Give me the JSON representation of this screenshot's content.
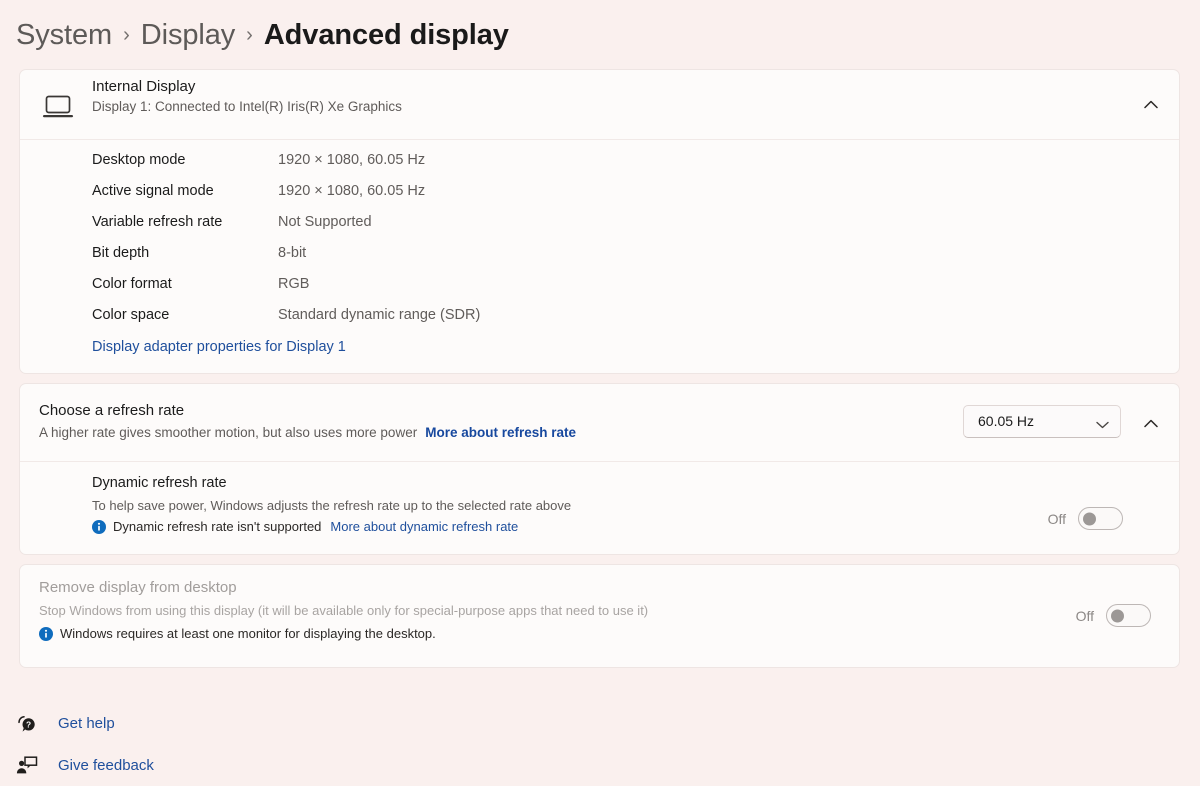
{
  "breadcrumb": {
    "items": [
      {
        "label": "System",
        "current": false
      },
      {
        "label": "Display",
        "current": false
      },
      {
        "label": "Advanced display",
        "current": true
      }
    ],
    "separator": "›"
  },
  "display_card": {
    "title": "Internal Display",
    "subtitle": "Display 1: Connected to Intel(R) Iris(R) Xe Graphics",
    "icon": "laptop-icon",
    "expander_icon": "chevron-up-icon",
    "details": [
      {
        "label": "Desktop mode",
        "value": "1920 × 1080, 60.05 Hz"
      },
      {
        "label": "Active signal mode",
        "value": "1920 × 1080, 60.05 Hz"
      },
      {
        "label": "Variable refresh rate",
        "value": "Not Supported"
      },
      {
        "label": "Bit depth",
        "value": "8-bit"
      },
      {
        "label": "Color format",
        "value": "RGB"
      },
      {
        "label": "Color space",
        "value": "Standard dynamic range (SDR)"
      }
    ],
    "adapter_link": "Display adapter properties for Display 1"
  },
  "refresh_card": {
    "title": "Choose a refresh rate",
    "description": "A higher rate gives smoother motion, but also uses more power",
    "more_link": "More about refresh rate",
    "dropdown_value": "60.05 Hz",
    "dropdown_icon": "chevron-down-icon",
    "expander_icon": "chevron-up-icon",
    "dynamic": {
      "title": "Dynamic refresh rate",
      "description": "To help save power, Windows adjusts the refresh rate up to the selected rate above",
      "info_icon": "info-icon",
      "info_text": "Dynamic refresh rate isn't supported",
      "info_link": "More about dynamic refresh rate",
      "toggle_label": "Off",
      "toggle_state": "off"
    }
  },
  "remove_card": {
    "title": "Remove display from desktop",
    "description": "Stop Windows from using this display (it will be available only for special-purpose apps that need to use it)",
    "info_icon": "info-icon",
    "info_text": "Windows requires at least one monitor for displaying the desktop.",
    "toggle_label": "Off",
    "toggle_state": "off"
  },
  "footer": {
    "links": [
      {
        "label": "Get help",
        "icon": "help-question-bubble-icon"
      },
      {
        "label": "Give feedback",
        "icon": "feedback-person-bubble-icon"
      }
    ]
  },
  "colors": {
    "page_background": "#faf0ee",
    "card_background": "#fdfbfa",
    "link": "#1f4f9c",
    "info_accent": "#0f6cbd",
    "text_primary": "#1b1b1b",
    "text_secondary": "#5f5b59",
    "text_disabled": "#a19d9b"
  }
}
